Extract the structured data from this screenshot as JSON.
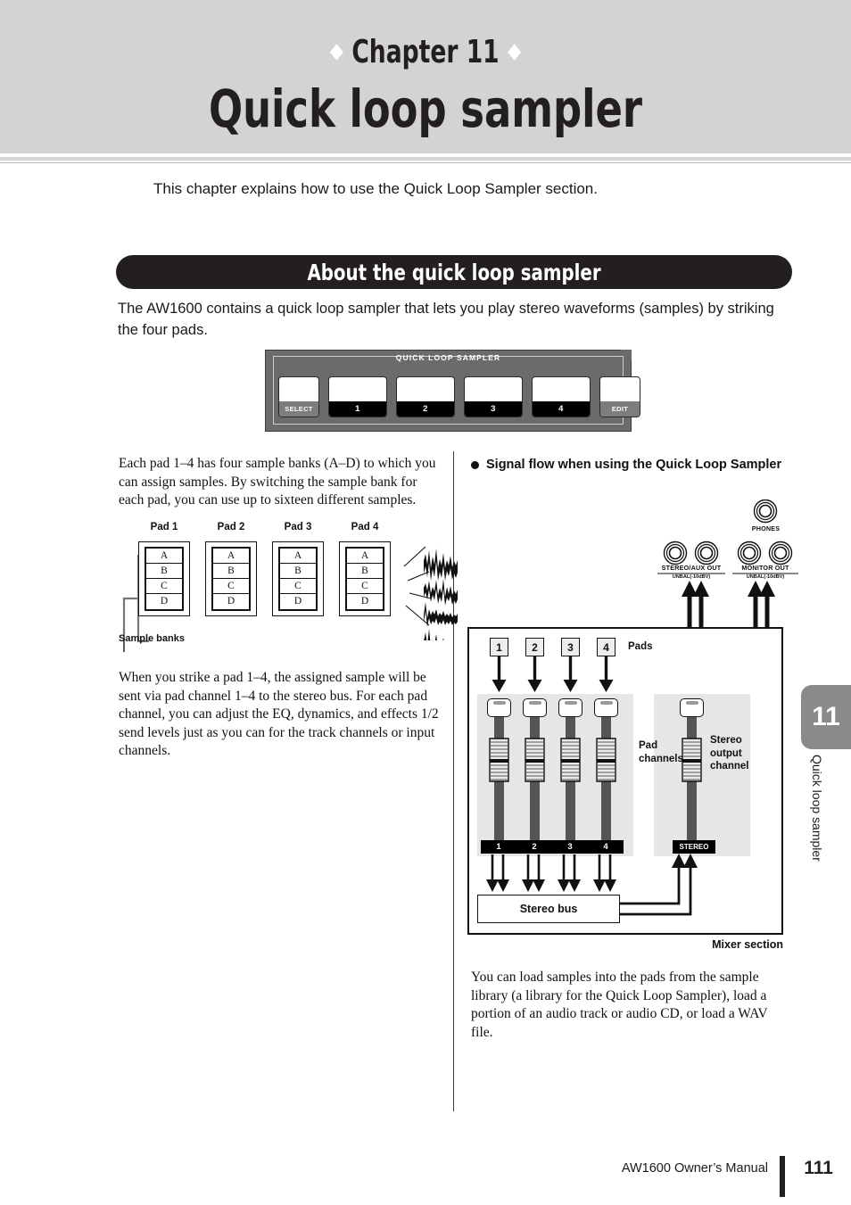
{
  "header": {
    "chapter_label": "Chapter 11",
    "chapter_title": "Quick loop sampler"
  },
  "intro": "This chapter explains how to use the Quick Loop Sampler section.",
  "section": {
    "banner_title": "About the quick loop sampler",
    "lead": "The AW1600 contains a quick loop sampler that lets you play stereo waveforms (samples) by striking the four pads."
  },
  "panel": {
    "caption": "QUICK  LOOP  SAMPLER",
    "buttons": [
      {
        "label": "SELECT",
        "type": "gray"
      },
      {
        "label": "1",
        "type": "black"
      },
      {
        "label": "2",
        "type": "black"
      },
      {
        "label": "3",
        "type": "black"
      },
      {
        "label": "4",
        "type": "black"
      },
      {
        "label": "EDIT",
        "type": "gray"
      }
    ]
  },
  "left_column": {
    "paragraph_1": "Each pad 1–4 has four sample banks (A–D) to which you can assign samples. By switching the sample bank for each pad, you can use up to sixteen different samples.",
    "paragraph_2": "When you strike a pad 1–4, the assigned sample will be sent via pad channel 1–4 to the stereo bus. For each pad channel, you can adjust the EQ, dynamics, and effects 1/2 send levels just as you can for the track channels or input channels.",
    "bank_diagram": {
      "pads": [
        {
          "title": "Pad 1",
          "banks": [
            "A",
            "B",
            "C",
            "D"
          ]
        },
        {
          "title": "Pad 2",
          "banks": [
            "A",
            "B",
            "C",
            "D"
          ]
        },
        {
          "title": "Pad 3",
          "banks": [
            "A",
            "B",
            "C",
            "D"
          ]
        },
        {
          "title": "Pad 4",
          "banks": [
            "A",
            "B",
            "C",
            "D"
          ]
        }
      ],
      "bracket_label": "Sample banks"
    }
  },
  "right_column": {
    "heading": "Signal flow when using the Quick Loop Sampler",
    "jacks": [
      {
        "label": "STEREO/AUX OUT",
        "sub": "UNBAL(-10dBV)"
      },
      {
        "label": "MONITOR OUT",
        "sub": "UNBAL(-10dBV)"
      },
      {
        "label": "PHONES",
        "sub": ""
      }
    ],
    "mixer": {
      "pads_label": "Pads",
      "pad_numbers": [
        "1",
        "2",
        "3",
        "4"
      ],
      "pad_channels_label": "Pad\nchannels",
      "pad_channels_label_line1": "Pad",
      "pad_channels_label_line2": "channels",
      "stereo_channel_label_line1": "Stereo",
      "stereo_channel_label_line2": "output",
      "stereo_channel_label_line3": "channel",
      "channel_bar_numbers": [
        "1",
        "2",
        "3",
        "4"
      ],
      "stereo_bar_label": "STEREO",
      "stereo_bus_label": "Stereo bus",
      "caption": "Mixer section"
    },
    "paragraph_bottom": "You can load samples into the pads from the sample library (a library for the Quick Loop Sampler), load a portion of an audio track or audio CD, or load a WAV file."
  },
  "side_tab": {
    "number": "11",
    "text": "Quick loop sampler"
  },
  "footer": {
    "manual": "AW1600  Owner’s Manual",
    "page": "111"
  },
  "colors": {
    "band": "#d3d3d3",
    "banner": "#231f20",
    "panel": "#6b6b6b",
    "fader": "#555555",
    "strip_bg": "#e6e6e6",
    "tab": "#8a8a8a"
  }
}
